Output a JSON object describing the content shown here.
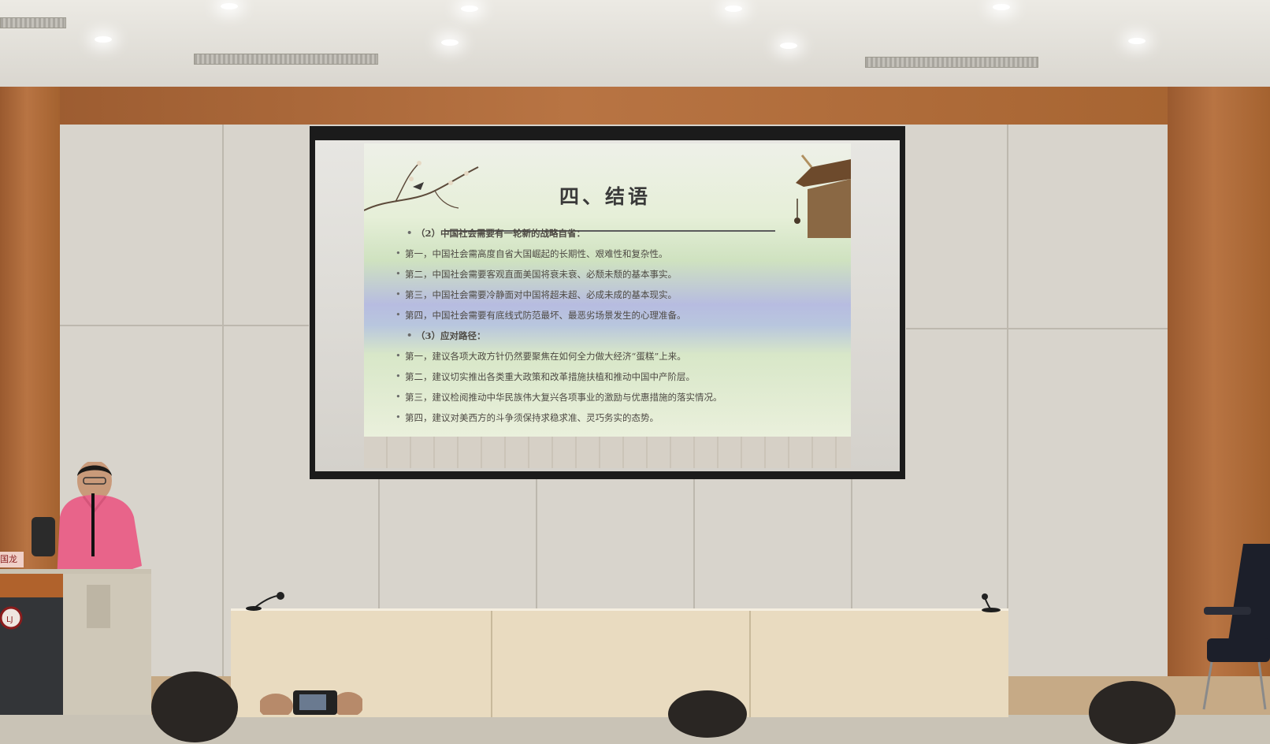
{
  "slide": {
    "title": "四、结语",
    "bullets": [
      "（2）中国社会需要有一轮新的战略自省：",
      "第一，中国社会需高度自省大国崛起的长期性、艰难性和复杂性。",
      "第二，中国社会需要客观直面美国将衰未衰、必颓未颓的基本事实。",
      "第三，中国社会需要冷静面对中国将超未超、必成未成的基本现实。",
      "第四，中国社会需要有底线式防范最坏、最恶劣场景发生的心理准备。",
      "（3）应对路径：",
      "第一，建议各项大政方针仍然要聚焦在如何全力做大经济“蛋糕”上来。",
      "第二，建议切实推出各类重大政策和改革措施扶植和推动中国中产阶层。",
      "第三，建议检阅推动中华民族伟大复兴各项事业的激励与优惠措施的落实情况。",
      "第四，建议对美西方的斗争须保持求稳求准、灵巧务实的态势。"
    ]
  },
  "nameplate": {
    "text": "国龙"
  },
  "colors": {
    "wood": "#a9673a",
    "shirt": "#e8648a",
    "screen_frame": "#1b1b1b"
  }
}
